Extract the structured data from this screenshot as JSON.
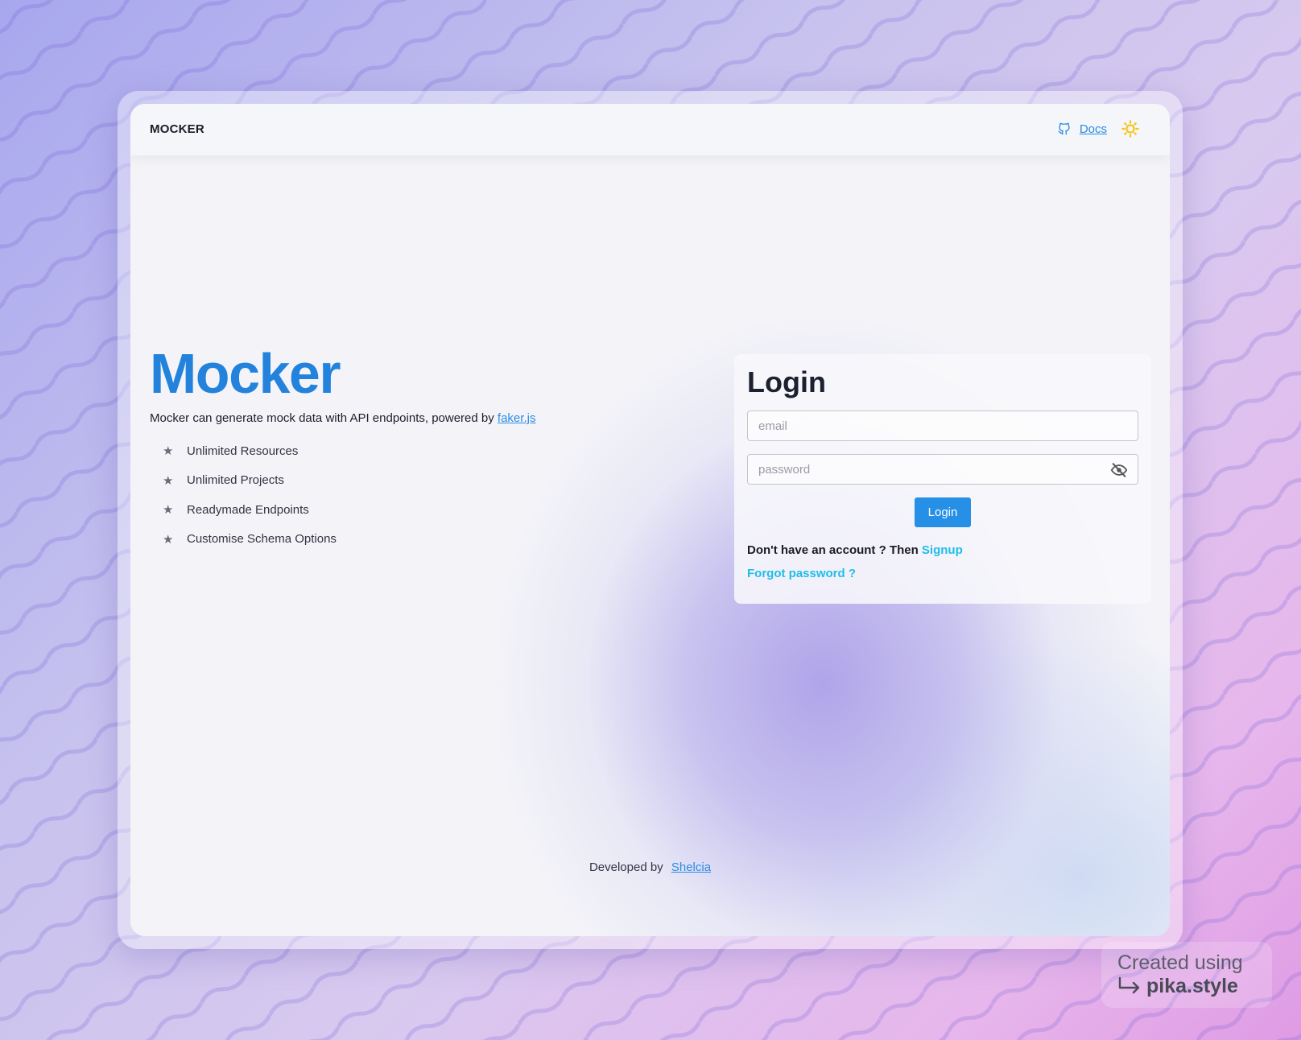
{
  "navbar": {
    "brand": "MOCKER",
    "docs_label": "Docs",
    "github_icon": "github-icon",
    "theme_icon": "sun-icon"
  },
  "hero": {
    "title": "Mocker",
    "subtitle_prefix": "Mocker can generate mock data with API endpoints, powered by ",
    "subtitle_link": "faker.js",
    "features": [
      "Unlimited Resources",
      "Unlimited Projects",
      "Readymade Endpoints",
      "Customise Schema Options"
    ],
    "feature_icon": "★"
  },
  "login": {
    "title": "Login",
    "email_placeholder": "email",
    "email_value": "",
    "password_placeholder": "password",
    "password_value": "",
    "button_label": "Login",
    "signup_prefix": "Don't have an account ? Then ",
    "signup_link": "Signup",
    "forgot_link": "Forgot password ?"
  },
  "footer": {
    "prefix": "Developed by",
    "link": "Shelcia"
  },
  "watermark": {
    "line1": "Created using",
    "line2": "pika.style"
  },
  "colors": {
    "accent": "#2383dc",
    "button": "#2590e6",
    "link_accent": "#1fbde8",
    "theme_icon": "#f5c518"
  }
}
